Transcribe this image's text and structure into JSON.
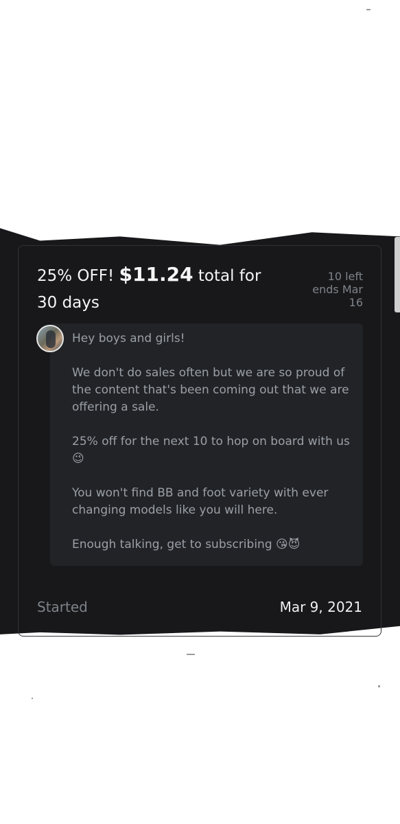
{
  "promo": {
    "title_prefix": "25% OFF!",
    "price": "$11.24",
    "title_suffix": "total for 30 days",
    "left": "10 left",
    "ends": "ends Mar 16"
  },
  "message": {
    "text": "Hey boys and girls!\n\nWe don't do sales often but we are so proud of the content that's been coming out that we are offering a sale.\n\n25% off for the next 10 to hop on board with us 😉\n\nYou won't find BB and foot variety with ever changing models like you will here.\n\nEnough talking, get to subscribing 😘😈"
  },
  "footer": {
    "label": "Started",
    "date": "Mar 9, 2021"
  }
}
